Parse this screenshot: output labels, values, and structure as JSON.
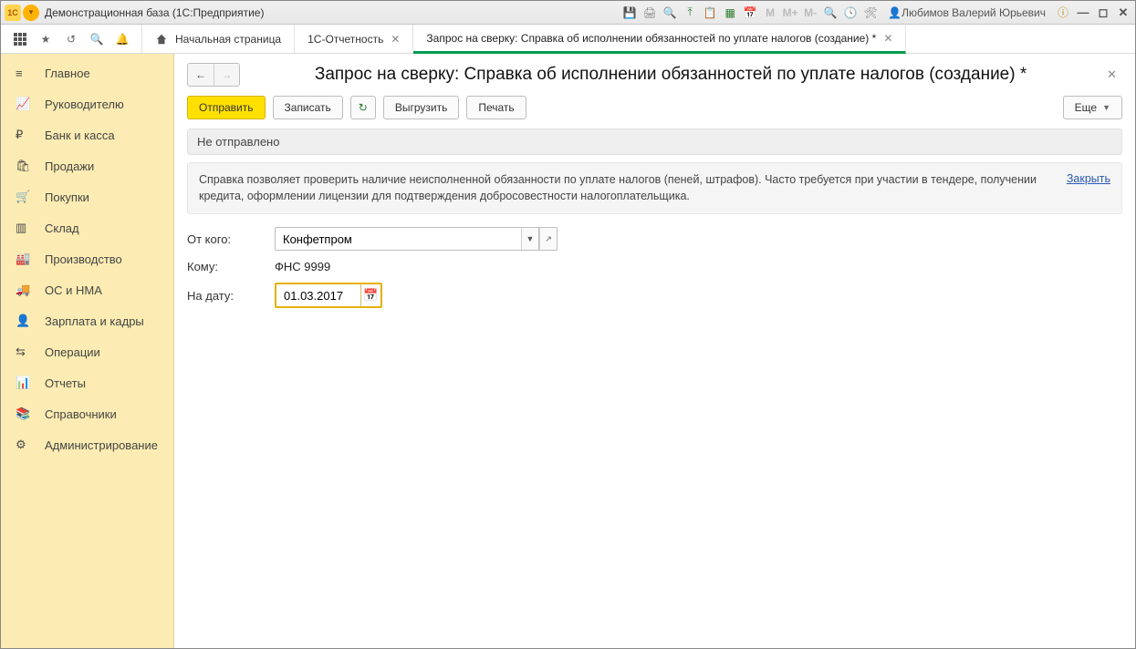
{
  "titlebar": {
    "title": "Демонстрационная база  (1С:Предприятие)",
    "user": "Любимов Валерий Юрьевич",
    "m1": "М",
    "m2": "М+",
    "m3": "М-"
  },
  "tabs": {
    "home": "Начальная страница",
    "tab1": "1С-Отчетность",
    "tab2": "Запрос на сверку: Справка об исполнении обязанностей по уплате налогов (создание) *"
  },
  "sidebar": {
    "items": [
      {
        "label": "Главное"
      },
      {
        "label": "Руководителю"
      },
      {
        "label": "Банк и касса"
      },
      {
        "label": "Продажи"
      },
      {
        "label": "Покупки"
      },
      {
        "label": "Склад"
      },
      {
        "label": "Производство"
      },
      {
        "label": "ОС и НМА"
      },
      {
        "label": "Зарплата и кадры"
      },
      {
        "label": "Операции"
      },
      {
        "label": "Отчеты"
      },
      {
        "label": "Справочники"
      },
      {
        "label": "Администрирование"
      }
    ]
  },
  "page": {
    "title": "Запрос на сверку: Справка об исполнении обязанностей по уплате налогов (создание) *",
    "btn_send": "Отправить",
    "btn_save": "Записать",
    "btn_export": "Выгрузить",
    "btn_print": "Печать",
    "btn_more": "Еще",
    "status": "Не отправлено",
    "info_text": "Справка позволяет проверить наличие неисполненной обязанности по уплате налогов (пеней, штрафов). Часто требуется при участии в тендере, получении кредита, оформлении лицензии для подтверждения добросовестности налогоплательщика.",
    "info_close": "Закрыть",
    "from_label": "От кого:",
    "from_value": "Конфетпром",
    "to_label": "Кому:",
    "to_value": "ФНС 9999",
    "date_label": "На дату:",
    "date_value": "01.03.2017"
  }
}
